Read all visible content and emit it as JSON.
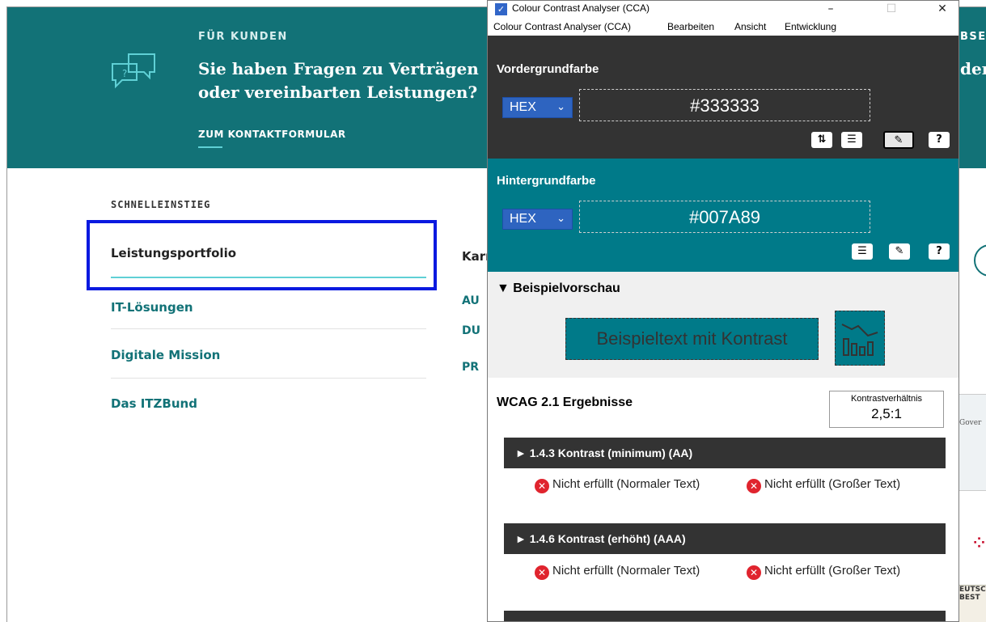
{
  "site": {
    "hero": {
      "label": "FÜR KUNDEN",
      "title": "Sie haben Fragen zu Verträgen oder vereinbarten Leistungen?",
      "link": "ZUM KONTAKTFORMULAR",
      "right_top": "BSE",
      "right_mid": "der"
    },
    "quick": {
      "heading": "SCHNELLEINSTIEG",
      "items": [
        "Leistungsportfolio",
        "IT-Lösungen",
        "Digitale Mission",
        "Das ITZBund"
      ],
      "col2": [
        "Karr",
        "AU",
        "DU",
        "PR"
      ]
    },
    "badge_text": "Gover",
    "badge2_text": "EUTSCH BEST"
  },
  "cca": {
    "title": "Colour Contrast Analyser (CCA)",
    "window_controls": {
      "minimize": "–",
      "maximize": "☐",
      "close": "✕"
    },
    "menu": [
      "Colour Contrast Analyser (CCA)",
      "Bearbeiten",
      "Ansicht",
      "Entwicklung"
    ],
    "foreground": {
      "title": "Vordergrundfarbe",
      "format": "HEX",
      "value": "#333333",
      "color": "#333333"
    },
    "background": {
      "title": "Hintergrundfarbe",
      "format": "HEX",
      "value": "#007A89",
      "color": "#007A89"
    },
    "preview": {
      "heading": "▼ Beispielvorschau",
      "sample_text": "Beispieltext mit Kontrast"
    },
    "results": {
      "heading": "WCAG 2.1 Ergebnisse",
      "ratio_label": "Kontrastverhältnis",
      "ratio_value": "2,5:1",
      "criteria": [
        {
          "label": "► 1.4.3 Kontrast (minimum) (AA)",
          "normal": "Nicht erfüllt (Normaler Text)",
          "large": "Nicht erfüllt (Großer Text)"
        },
        {
          "label": "► 1.4.6 Kontrast (erhöht) (AAA)",
          "normal": "Nicht erfüllt (Normaler Text)",
          "large": "Nicht erfüllt (Großer Text)"
        }
      ]
    }
  }
}
